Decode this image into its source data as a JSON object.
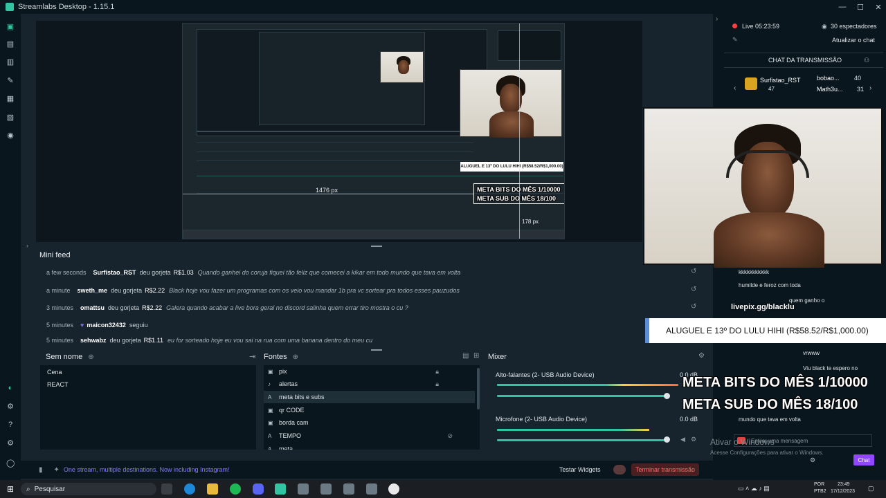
{
  "window": {
    "title": "Streamlabs Desktop - 1.15.1",
    "controls": [
      "—",
      "☐",
      "✕"
    ]
  },
  "preview": {
    "inner_meta_bits": "META BITS DO MÊS 1/10000",
    "inner_meta_subs": "META SUB DO MÊS 18/100",
    "inner_aluguel": "ALUGUEL E 13º DO LULU HIHI (R$58.52/R$1,000.00)",
    "px_readout": "1476 px",
    "px_readout2": "178 px"
  },
  "minifeed": {
    "title": "Mini feed",
    "rows": [
      {
        "time": "a few seconds",
        "user": "Surfistao_RST",
        "action": "deu gorjeta",
        "amount": "R$1.03",
        "message": "Quando ganhei do coruja fiquei tão feliz que comecei a kikar em todo mundo que tava em volta"
      },
      {
        "time": "a minute",
        "user": "sweth_me",
        "action": "deu gorjeta",
        "amount": "R$2.22",
        "message": "Black hoje vou fazer um programas com os veio vou mandar 1b pra vc sortear pra todos esses pauzudos"
      },
      {
        "time": "3 minutes",
        "user": "omattsu",
        "action": "deu gorjeta",
        "amount": "R$2.22",
        "message": "Galera quando acabar a live bora geral no discord salinha quem errar tiro mostra o cu ?"
      },
      {
        "time": "5 minutes",
        "user": "maicon32432",
        "action": "seguiu",
        "amount": "",
        "message": ""
      },
      {
        "time": "5 minutes",
        "user": "sehwabz",
        "action": "deu gorjeta",
        "amount": "R$1.11",
        "message": "eu for sorteado hoje eu vou sai na rua com uma banana dentro do meu cu"
      }
    ]
  },
  "scenes": {
    "title": "Sem nome",
    "items": [
      "Cena",
      "REACT"
    ]
  },
  "sources": {
    "title": "Fontes",
    "items": [
      {
        "icon": "image-icon",
        "label": "pix"
      },
      {
        "icon": "bell-icon",
        "label": "alertas"
      },
      {
        "icon": "text-icon",
        "label": "meta bits e subs"
      },
      {
        "icon": "image-icon",
        "label": "qr CODE"
      },
      {
        "icon": "image-icon",
        "label": "borda cam"
      },
      {
        "icon": "text-icon",
        "label": "TEMPO"
      },
      {
        "icon": "text-icon",
        "label": "meta"
      }
    ]
  },
  "mixer": {
    "title": "Mixer",
    "channels": [
      {
        "name": "Alto-falantes (2- USB Audio Device)",
        "level_db": "0.0 dB",
        "volume": 0.97
      },
      {
        "name": "Microfone (2- USB Audio Device)",
        "level_db": "0.0 dB",
        "volume": 0.97
      }
    ]
  },
  "footer": {
    "promo": "One stream, multiple destinations. Now including Instagram!",
    "test_widgets": "Testar Widgets",
    "end_stream": "Terminar transmissão"
  },
  "live": {
    "status": "Live 05:23:59",
    "viewers": "30 espectadores",
    "refresh_chat": "Atualizar o chat",
    "chat_title": "CHAT DA TRANSMISSÃO",
    "leaders": [
      {
        "name": "Surfistao_RST",
        "count": "47"
      },
      {
        "name": "bobao...",
        "count": "40"
      },
      {
        "name": "Math3u...",
        "count": "31"
      }
    ]
  },
  "overlay": {
    "link": "livepix.gg/blacklu",
    "aluguel": "ALUGUEL E 13º DO LULU HIHI (R$58.52/R$1,000.00)",
    "meta_bits": "META BITS DO MÊS 1/10000",
    "meta_subs": "META SUB DO MÊS 18/100"
  },
  "chat": {
    "lines": [
      "kkkkkkkkkkk",
      "humilde e feroz com toda",
      "quem ganho o",
      "vrwww",
      "Viu black te espero no",
      "mundo que tava em volta"
    ],
    "input_placeholder": "Enviar uma mensagem",
    "send_label": "Chat",
    "watermark1": "Ativar o Windows",
    "watermark2": "Acesse Configurações para ativar o Windows."
  },
  "taskbar": {
    "search": "Pesquisar",
    "lang1": "POR",
    "lang2": "PTB2",
    "time": "23:49",
    "date": "17/12/2023"
  }
}
